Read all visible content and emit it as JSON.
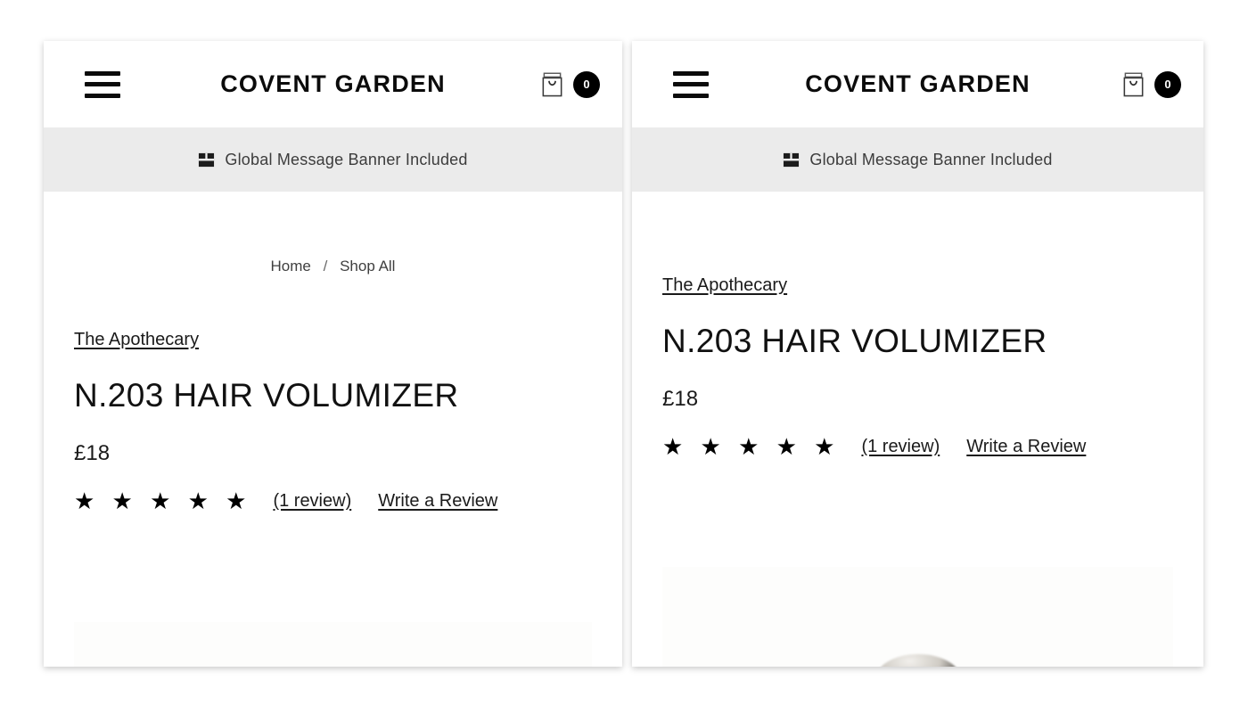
{
  "header": {
    "menu_icon": "hamburger-menu-icon",
    "brand": "COVENT GARDEN",
    "cart_icon": "shopping-jar-icon",
    "cart_count": "0"
  },
  "banner": {
    "icon": "package-box-icon",
    "text": "Global Message Banner Included",
    "background": "#ebebeb"
  },
  "breadcrumb": {
    "home": "Home",
    "separator": "/",
    "current": "Shop All"
  },
  "product": {
    "vendor": "The Apothecary",
    "title": "N.203 HAIR VOLUMIZER",
    "price": "£18",
    "stars": "★ ★ ★ ★ ★",
    "rating_value": 5,
    "review_count": "(1 review)",
    "write_review": "Write a Review"
  },
  "colors": {
    "text": "#111111",
    "banner_bg": "#ebebeb",
    "badge_bg": "#000000",
    "page_bg": "#ffffff"
  }
}
